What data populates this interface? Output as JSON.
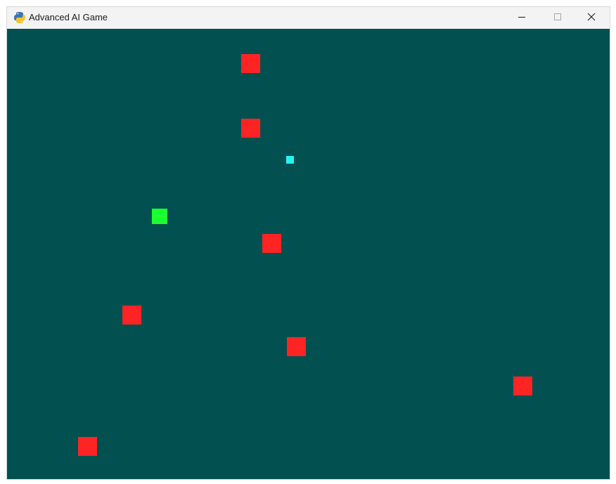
{
  "window": {
    "title": "Advanced AI Game",
    "icon": "pygame-snake-icon",
    "controls": {
      "minimize_icon": "minimize-icon",
      "maximize_icon": "maximize-icon",
      "close_icon": "close-icon"
    }
  },
  "game": {
    "background_color": "#025050",
    "player_color": "#1aff30",
    "enemy_color": "#fe2424",
    "pickup_color": "#22f4ef"
  }
}
